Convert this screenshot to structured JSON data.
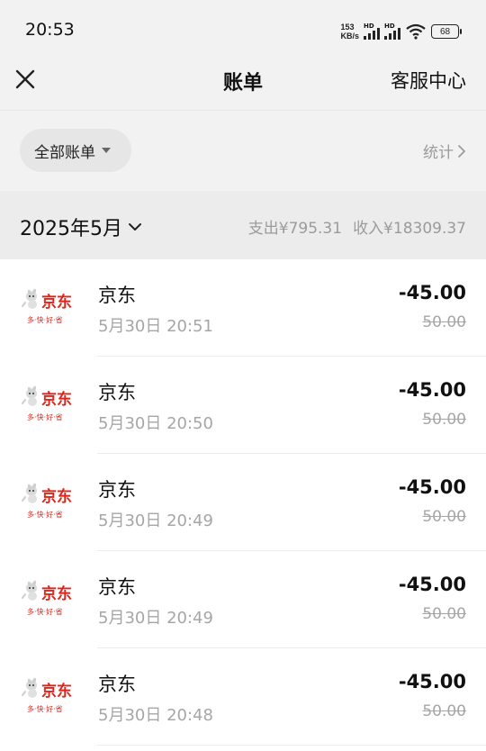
{
  "status_bar": {
    "time": "20:53",
    "net_speed_value": "153",
    "net_speed_unit": "KB/s",
    "hd_label": "HD",
    "battery": "68"
  },
  "header": {
    "title": "账单",
    "service_label": "客服中心"
  },
  "filter": {
    "selected": "全部账单",
    "stats_label": "统计"
  },
  "month": {
    "label": "2025年5月",
    "expense": "支出¥795.31",
    "income": "收入¥18309.37"
  },
  "bills": [
    {
      "merchant": "京东",
      "time": "5月30日 20:51",
      "amount": "-45.00",
      "original": "50.00"
    },
    {
      "merchant": "京东",
      "time": "5月30日 20:50",
      "amount": "-45.00",
      "original": "50.00"
    },
    {
      "merchant": "京东",
      "time": "5月30日 20:49",
      "amount": "-45.00",
      "original": "50.00"
    },
    {
      "merchant": "京东",
      "time": "5月30日 20:49",
      "amount": "-45.00",
      "original": "50.00"
    },
    {
      "merchant": "京东",
      "time": "5月30日 20:48",
      "amount": "-45.00",
      "original": "50.00"
    }
  ],
  "logo": {
    "brand_text": "京东",
    "slogan": "多·快·好·省",
    "brand_color": "#e1251b"
  }
}
